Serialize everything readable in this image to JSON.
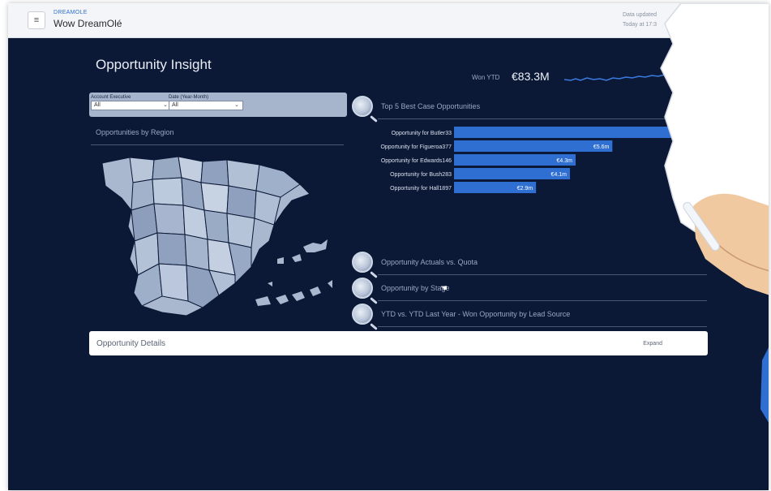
{
  "app": {
    "subtitle": "DREAMOLE",
    "title": "Wow DreamOlé",
    "updated_line1": "Data updated",
    "updated_line2": "Today at 17:3"
  },
  "dashboard": {
    "title": "Opportunity Insight",
    "ytd_label": "Won YTD",
    "ytd_value": "€83.3M"
  },
  "filters": [
    {
      "label": "Account Executive",
      "value": "All"
    },
    {
      "label": "Date (Year-Month)",
      "value": "All"
    }
  ],
  "sections": {
    "by_region": "Opportunities by Region",
    "top5": "Top 5 Best Case Opportunities",
    "actuals_vs_quota": "Opportunity Actuals vs. Quota",
    "by_stage": "Opportunity by Stage",
    "ytd_lead_source": "YTD vs. YTD Last Year - Won Opportunity by Lead Source"
  },
  "chart_data": {
    "type": "bar",
    "title": "Top 5 Best Case Opportunities",
    "categories": [
      "Opportunity for Butler33",
      "Opportunity for Figueroa377",
      "Opportunity for Edwards146",
      "Opportunity for Bush283",
      "Opportunity for Hall1897"
    ],
    "values": [
      8.6,
      5.6,
      4.3,
      4.1,
      2.9
    ],
    "data_labels": [
      "",
      "€5.6m",
      "€4.3m",
      "€4.1m",
      "€2.9m"
    ],
    "color": "#2f6fd1"
  },
  "details": {
    "title": "Opportunity Details",
    "expand": "Expand"
  },
  "colors": {
    "background": "#0b1836",
    "bar": "#2f6fd1",
    "map_fill": "#a9b8cf"
  }
}
